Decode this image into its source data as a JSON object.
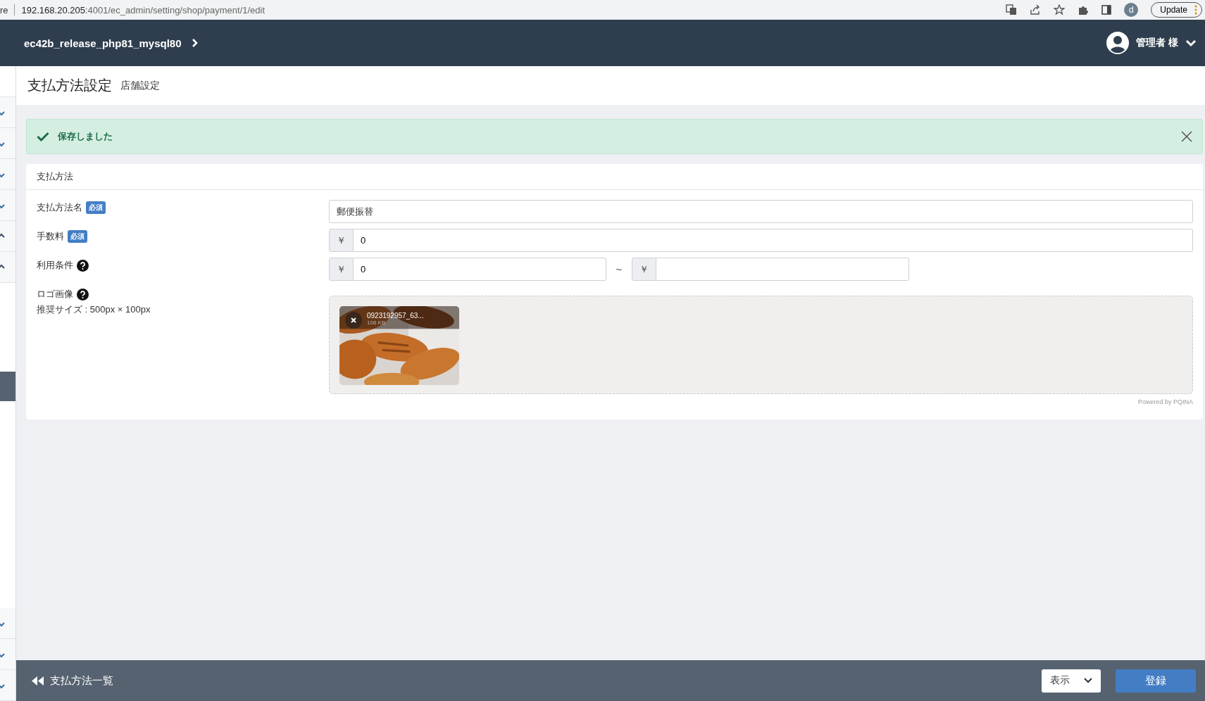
{
  "browser": {
    "tab_text": "re",
    "url_host": "192.168.20.205",
    "url_path": ":4001/ec_admin/setting/shop/payment/1/edit",
    "profile_initial": "d",
    "update_button": "Update"
  },
  "header": {
    "shop_name": "ec42b_release_php81_mysql80",
    "user_name": "管理者 様"
  },
  "sidebar": {
    "items": [
      {
        "expanded": false
      },
      {
        "expanded": false
      },
      {
        "expanded": false
      },
      {
        "expanded": false
      },
      {
        "expanded": true
      },
      {
        "expanded": true,
        "children": [
          {
            "selected": true
          }
        ]
      },
      {
        "expanded": false
      },
      {
        "expanded": false
      },
      {
        "expanded": false
      }
    ]
  },
  "page": {
    "title": "支払方法設定",
    "subtitle": "店舗設定"
  },
  "alert": {
    "message": "保存しました"
  },
  "card": {
    "title": "支払方法",
    "fields": [
      {
        "kind": "text",
        "label": "支払方法名",
        "required": true,
        "badge": "必須",
        "value": "郵便振替"
      },
      {
        "kind": "price",
        "label": "手数料",
        "required": true,
        "badge": "必須",
        "prefix": "￥",
        "value": "0"
      },
      {
        "kind": "range",
        "label": "利用条件",
        "help": true,
        "from": {
          "prefix": "￥",
          "value": "0"
        },
        "separator": "~",
        "to": {
          "prefix": "￥"
        }
      },
      {
        "label": "ロゴ画像",
        "help": true,
        "note": "推奨サイズ : 500px × 100px",
        "file": {
          "name": "0923192957_63...",
          "size": "106 KB",
          "kind": "picture"
        },
        "credit": "Powered by PQINA"
      }
    ]
  },
  "footer": {
    "back_link": "支払方法一覧",
    "visibility": "表示",
    "submit": "登録"
  }
}
